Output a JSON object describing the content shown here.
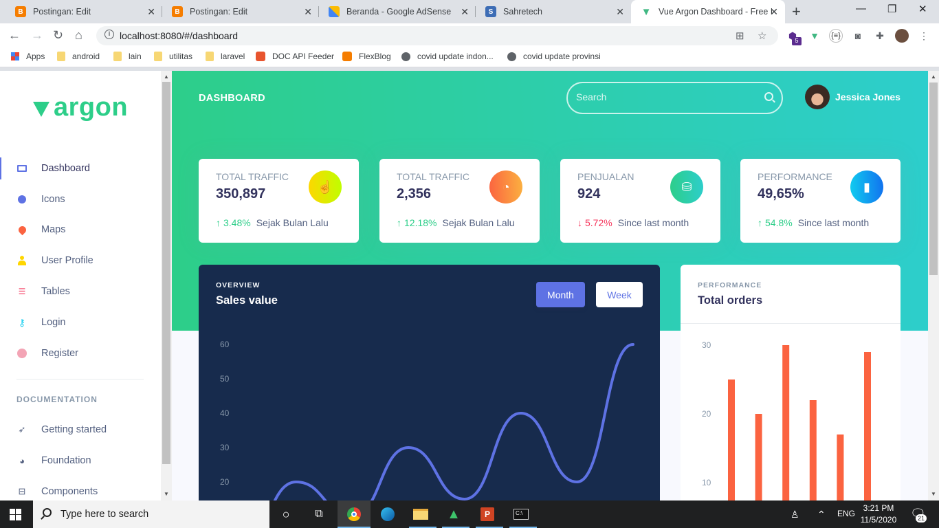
{
  "browser": {
    "tabs": [
      {
        "title": "Postingan: Edit",
        "icon": "blogger-icon",
        "color": "#f57d00"
      },
      {
        "title": "Postingan: Edit",
        "icon": "blogger-icon",
        "color": "#f57d00"
      },
      {
        "title": "Beranda - Google AdSense",
        "icon": "adsense-icon",
        "color": "#fbbc04"
      },
      {
        "title": "Sahretech",
        "icon": "sahretech-icon",
        "color": "#3d6db5"
      },
      {
        "title": "Vue Argon Dashboard - Free D",
        "icon": "vue-icon",
        "color": "#41b883"
      }
    ],
    "url": "localhost:8080/#/dashboard",
    "bookmarks": [
      {
        "label": "Apps",
        "icon": "apps-grid-icon"
      },
      {
        "label": "android",
        "icon": "folder-icon"
      },
      {
        "label": "lain",
        "icon": "folder-icon"
      },
      {
        "label": "utilitas",
        "icon": "folder-icon"
      },
      {
        "label": "laravel",
        "icon": "folder-icon"
      },
      {
        "label": "DOC API Feeder",
        "icon": "feeder-icon"
      },
      {
        "label": "FlexBlog",
        "icon": "blogger-icon"
      },
      {
        "label": "covid update indon...",
        "icon": "globe-icon"
      },
      {
        "label": "covid update provinsi",
        "icon": "globe-icon"
      }
    ],
    "extension_badge": "5"
  },
  "sidebar": {
    "logo": "argon",
    "items": [
      {
        "label": "Dashboard",
        "icon": "tv-icon",
        "color": "#5e72e4"
      },
      {
        "label": "Icons",
        "icon": "planet-icon",
        "color": "#5e72e4"
      },
      {
        "label": "Maps",
        "icon": "pin-icon",
        "color": "#fb6340"
      },
      {
        "label": "User Profile",
        "icon": "user-icon",
        "color": "#ffd600"
      },
      {
        "label": "Tables",
        "icon": "bullet-list-icon",
        "color": "#f5365c"
      },
      {
        "label": "Login",
        "icon": "key-icon",
        "color": "#11cdef"
      },
      {
        "label": "Register",
        "icon": "circle-user-icon",
        "color": "#f3a4b5"
      }
    ],
    "doc_heading": "DOCUMENTATION",
    "doc_items": [
      {
        "label": "Getting started",
        "icon": "spaceship-icon"
      },
      {
        "label": "Foundation",
        "icon": "palette-icon"
      },
      {
        "label": "Components",
        "icon": "ui-components-icon"
      }
    ]
  },
  "header": {
    "title": "DASHBOARD",
    "search_placeholder": "Search",
    "user_name": "Jessica Jones"
  },
  "stats": [
    {
      "label": "Total traffic",
      "value": "350,897",
      "pct": "3.48%",
      "trend": "up",
      "note": "Sejak Bulan Lalu",
      "icon": "hand-pointer-icon",
      "color": "#ffd600"
    },
    {
      "label": "Total traffic",
      "value": "2,356",
      "pct": "12.18%",
      "trend": "up",
      "note": "Sejak Bulan Lalu",
      "icon": "pie-chart-icon",
      "color": "#fb6340"
    },
    {
      "label": "Penjualan",
      "value": "924",
      "pct": "5.72%",
      "trend": "down",
      "note": "Since last month",
      "icon": "money-coins-icon",
      "color": "#2dce89"
    },
    {
      "label": "Performance",
      "value": "49,65%",
      "pct": "54.8%",
      "trend": "up",
      "note": "Since last month",
      "icon": "bar-chart-icon",
      "color": "#11cdef"
    }
  ],
  "sales_card": {
    "subtitle": "OVERVIEW",
    "title": "Sales value",
    "btn_month": "Month",
    "btn_week": "Week"
  },
  "orders_card": {
    "subtitle": "PERFORMANCE",
    "title": "Total orders"
  },
  "chart_data": [
    {
      "type": "line",
      "ylim": [
        0,
        60
      ],
      "yticks": [
        20,
        30,
        40,
        50,
        60
      ],
      "series": [
        {
          "values": [
            0,
            20,
            10,
            30,
            15,
            40,
            20,
            60
          ]
        }
      ],
      "color": "#5e72e4"
    },
    {
      "type": "bar",
      "ylim": [
        0,
        30
      ],
      "yticks": [
        10,
        20,
        30
      ],
      "values": [
        25,
        20,
        30,
        22,
        17,
        29
      ],
      "color": "#fb6340"
    }
  ],
  "taskbar": {
    "search_text": "Type here to search",
    "language": "ENG",
    "time": "3:21 PM",
    "date": "11/5/2020",
    "notifications": "21"
  }
}
